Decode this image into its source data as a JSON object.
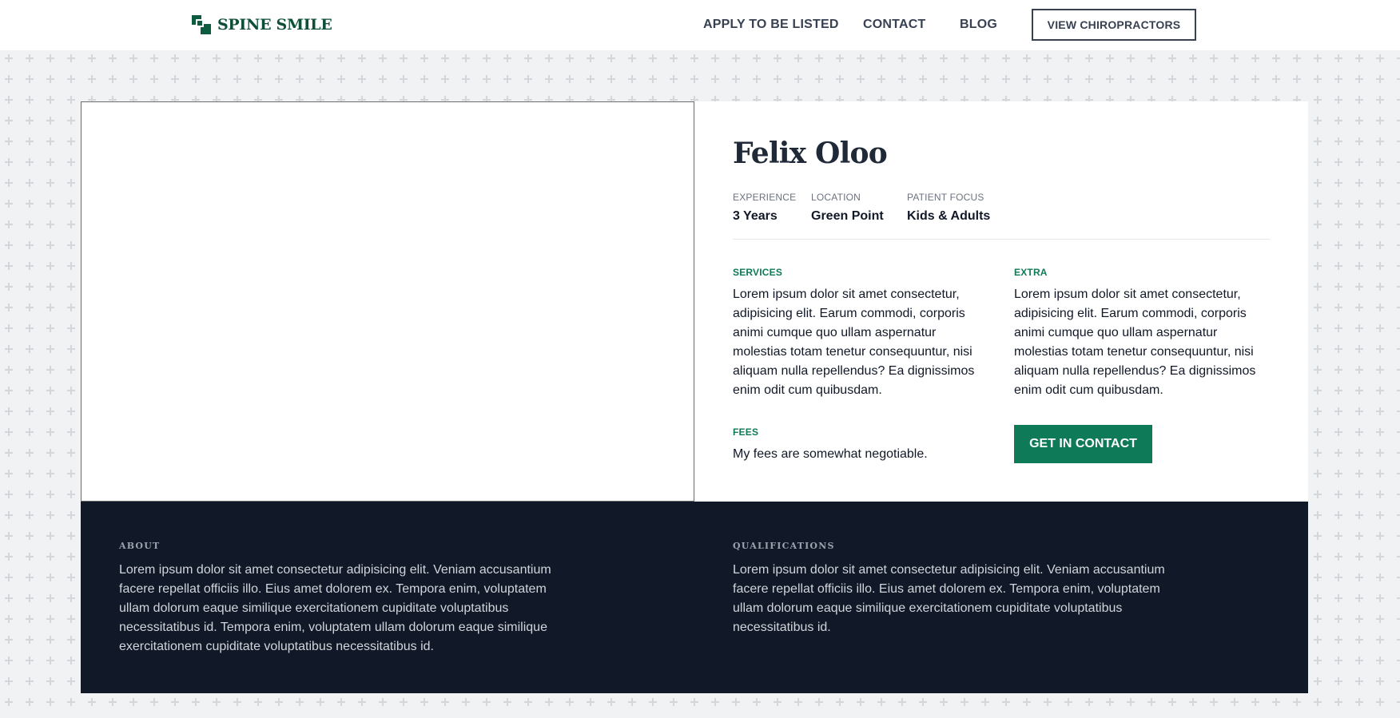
{
  "header": {
    "logo_text": "SPINE SMILE",
    "nav": [
      {
        "label": "APPLY TO BE LISTED"
      },
      {
        "label": "CONTACT"
      },
      {
        "label": "BLOG"
      }
    ],
    "cta_label": "VIEW CHIROPRACTORS"
  },
  "profile": {
    "name": "Felix Oloo",
    "stats": [
      {
        "label": "EXPERIENCE",
        "value": "3 Years"
      },
      {
        "label": "LOCATION",
        "value": "Green Point"
      },
      {
        "label": "PATIENT FOCUS",
        "value": "Kids & Adults"
      }
    ],
    "services": {
      "label": "SERVICES",
      "text": "Lorem ipsum dolor sit amet consectetur, adipisicing elit. Earum commodi, corporis animi cumque quo ullam aspernatur molestias totam tenetur consequuntur, nisi aliquam nulla repellendus? Ea dignissimos enim odit cum quibusdam."
    },
    "extra": {
      "label": "EXTRA",
      "text": "Lorem ipsum dolor sit amet consectetur, adipisicing elit. Earum commodi, corporis animi cumque quo ullam aspernatur molestias totam tenetur consequuntur, nisi aliquam nulla repellendus? Ea dignissimos enim odit cum quibusdam."
    },
    "fees": {
      "label": "FEES",
      "text": "My fees are somewhat negotiable."
    },
    "contact_button": "GET IN CONTACT"
  },
  "details": {
    "about": {
      "label": "ABOUT",
      "text": "Lorem ipsum dolor sit amet consectetur adipisicing elit. Veniam accusantium facere repellat officiis illo. Eius amet dolorem ex. Tempora enim, voluptatem ullam dolorum eaque similique exercitationem cupiditate voluptatibus necessitatibus id. Tempora enim, voluptatem ullam dolorum eaque similique exercitationem cupiditate voluptatibus necessitatibus id."
    },
    "qualifications": {
      "label": "QUALIFICATIONS",
      "text": "Lorem ipsum dolor sit amet consectetur adipisicing elit. Veniam accusantium facere repellat officiis illo. Eius amet dolorem ex. Tempora enim, voluptatem ullam dolorum eaque similique exercitationem cupiditate voluptatibus necessitatibus id."
    }
  },
  "colors": {
    "brand_green": "#0f7a57",
    "logo_green": "#0d4f37",
    "dark_panel": "#111827",
    "page_bg": "#f1f2f4"
  }
}
